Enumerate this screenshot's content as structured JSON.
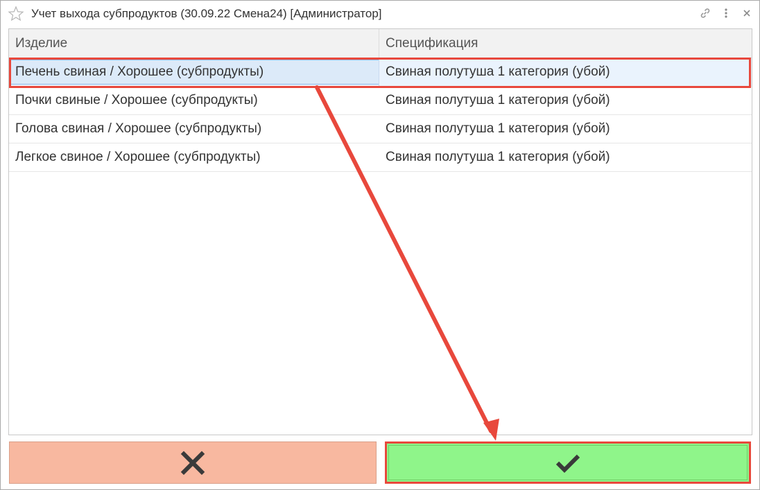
{
  "window": {
    "title": "Учет выхода субпродуктов (30.09.22 Смена24) [Администратор]",
    "icons": [
      "star-icon",
      "link-icon",
      "more-icon",
      "close-icon"
    ]
  },
  "table": {
    "columns": [
      "Изделие",
      "Спецификация"
    ],
    "rows": [
      {
        "product": "Печень свиная / Хорошее (субпродукты)",
        "spec": "Свиная полутуша 1 категория (убой)",
        "selected": true
      },
      {
        "product": "Почки свиные / Хорошее (субпродукты)",
        "spec": "Свиная полутуша 1 категория (убой)",
        "selected": false
      },
      {
        "product": "Голова свиная / Хорошее (субпродукты)",
        "spec": "Свиная полутуша 1 категория (убой)",
        "selected": false
      },
      {
        "product": "Легкое свиное / Хорошее (субпродукты)",
        "spec": "Свиная полутуша 1 категория (убой)",
        "selected": false
      }
    ]
  },
  "buttons": {
    "cancel_icon": "x-icon",
    "ok_icon": "checkmark-icon"
  },
  "colors": {
    "cancel_bg": "#f8b8a0",
    "ok_bg": "#8ff58a",
    "annotation": "#e8483c",
    "selection": "#dceaf9"
  }
}
